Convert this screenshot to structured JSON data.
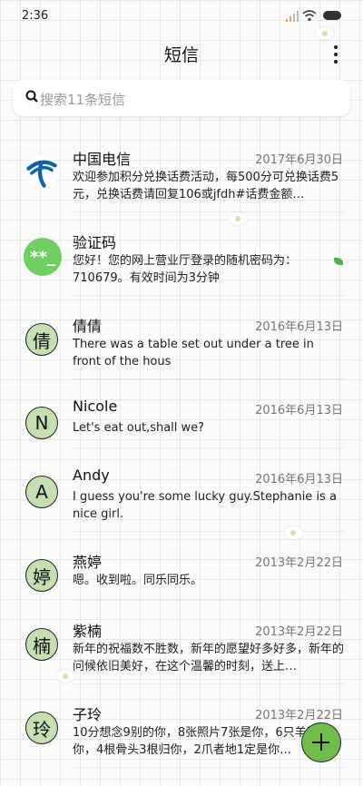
{
  "status_bar": {
    "time": "2:36"
  },
  "header": {
    "title": "短信"
  },
  "search": {
    "placeholder": "搜索11条短信"
  },
  "messages": [
    {
      "sender": "中国电信",
      "date": "2017年6月30日",
      "preview": "欢迎参加积分兑换话费活动，每500分可兑换话费5元，兑换话费请回复106或jfdh#话费金额…",
      "avatar": {
        "type": "logo",
        "icon": "china-telecom-logo-icon",
        "color": "#0a64b4"
      }
    },
    {
      "sender": "验证码",
      "date": "",
      "preview": "您好！您的网上营业厅登录的随机密码为：710679。有效时间为3分钟",
      "avatar": {
        "type": "glyph",
        "text": "**_",
        "color": "#6fcf60"
      }
    },
    {
      "sender": "倩倩",
      "date": "2016年6月13日",
      "preview": "There was a table set out under a tree in front of the hous",
      "avatar": {
        "type": "letter",
        "text": "倩"
      }
    },
    {
      "sender": "Nicole",
      "date": "2016年6月13日",
      "preview": "Let's eat out,shall we?",
      "avatar": {
        "type": "letter",
        "text": "N"
      }
    },
    {
      "sender": "Andy",
      "date": "2016年6月13日",
      "preview": "I guess you're some lucky guy.Stephanie is a nice girl.",
      "avatar": {
        "type": "letter",
        "text": "A"
      }
    },
    {
      "sender": "燕婷",
      "date": "2013年2月22日",
      "preview": "嗯。收到啦。同乐同乐。",
      "avatar": {
        "type": "letter",
        "text": "婷"
      }
    },
    {
      "sender": "紫楠",
      "date": "2013年2月22日",
      "preview": "新年的祝福数不胜数，新年的愿望好多好多，新年的问候依旧美好，在这个温馨的时刻，送上…",
      "avatar": {
        "type": "letter",
        "text": "楠"
      }
    },
    {
      "sender": "子玲",
      "date": "2013年2月22日",
      "preview": "10分想念9别的你，8张照片7张是你，6只羊5只像你，4根骨头3根归你，2爪者地1定是你…",
      "avatar": {
        "type": "letter",
        "text": "玲"
      }
    }
  ],
  "fab": {
    "icon": "plus-icon",
    "color": "#6dbf4a"
  },
  "colors": {
    "avatar_bg": "#c5dfb1",
    "accent_green": "#6fcf60"
  }
}
